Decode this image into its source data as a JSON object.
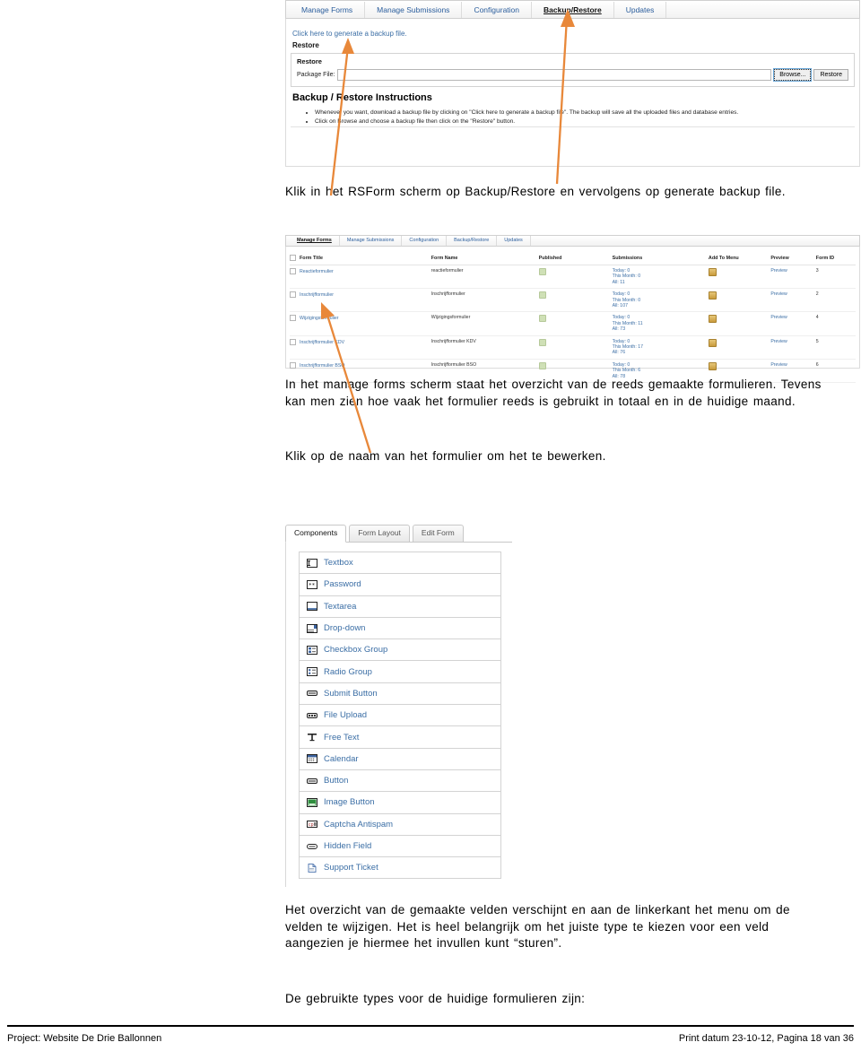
{
  "document": {
    "paragraphs": {
      "klik_backup": "Klik in het RSForm scherm op Backup/Restore en vervolgens op generate backup file.",
      "manage_forms": "In het manage forms scherm staat het overzicht van de reeds gemaakte formulieren. Tevens kan men zien hoe vaak het formulier reeds is gebruikt in totaal en in de huidige maand.",
      "klik_naam": "Klik op de naam van het formulier om het te bewerken.",
      "overzicht_velden": "Het overzicht van de gemaakte velden verschijnt en aan de linkerkant het menu om de velden te wijzigen. Het is heel belangrijk om het juiste type te kiezen voor een veld aangezien je hiermee het invullen kunt “sturen”.",
      "gebruikte_types": "De gebruikte types voor de huidige formulieren zijn:"
    },
    "footer": {
      "left": "Project: Website De Drie Ballonnen",
      "right": "Print datum 23-10-12, Pagina 18 van 36"
    }
  },
  "backup_screenshot": {
    "tabs": [
      {
        "label": "Manage Forms",
        "active": false
      },
      {
        "label": "Manage Submissions",
        "active": false
      },
      {
        "label": "Configuration",
        "active": false
      },
      {
        "label": "Backup/Restore",
        "active": true
      },
      {
        "label": "Updates",
        "active": false
      }
    ],
    "generate_link": "Click here to generate a backup file.",
    "restore_heading": "Restore",
    "panel_title": "Restore",
    "package_file_label": "Package File:",
    "package_file_value": "",
    "browse_button": "Browse...",
    "restore_button": "Restore",
    "instructions_heading": "Backup / Restore Instructions",
    "instructions": [
      "Whenever you want, download a backup file by clicking on \"Click here to generate a backup file\". The backup will save all the uploaded files and database entries.",
      "Click on Browse and choose a backup file then click on the \"Restore\" button."
    ]
  },
  "forms_screenshot": {
    "tabs": [
      {
        "label": "Manage Forms",
        "active": true
      },
      {
        "label": "Manage Submissions",
        "active": false
      },
      {
        "label": "Configuration",
        "active": false
      },
      {
        "label": "Backup/Restore",
        "active": false
      },
      {
        "label": "Updates",
        "active": false
      }
    ],
    "columns": [
      "Form Title",
      "Form Name",
      "Published",
      "Submissions",
      "Add To Menu",
      "Preview",
      "Form ID"
    ],
    "rows": [
      {
        "title": "Reactieformulier",
        "name": "reactieformulier",
        "published": true,
        "today": "Today: 0",
        "this_month": "This Month: 0",
        "all": "All: 11",
        "preview": "Preview",
        "form_id": "3"
      },
      {
        "title": "Inschrijfformulier",
        "name": "Inschrijfformulier",
        "published": true,
        "today": "Today: 0",
        "this_month": "This Month: 0",
        "all": "All: 107",
        "preview": "Preview",
        "form_id": "2"
      },
      {
        "title": "Wijzigingsformulier",
        "name": "Wijzigingsformulier",
        "published": true,
        "today": "Today: 0",
        "this_month": "This Month: 11",
        "all": "All: 73",
        "preview": "Preview",
        "form_id": "4"
      },
      {
        "title": "Inschrijfformulier KDV",
        "name": "Inschrijfformulier KDV",
        "published": true,
        "today": "Today: 0",
        "this_month": "This Month: 17",
        "all": "All: 76",
        "preview": "Preview",
        "form_id": "5"
      },
      {
        "title": "Inschrijfformulier BSO",
        "name": "Inschrijfformulier BSO",
        "published": true,
        "today": "Today: 0",
        "this_month": "This Month: 6",
        "all": "All: 78",
        "preview": "Preview",
        "form_id": "6"
      }
    ]
  },
  "components_screenshot": {
    "tabs": [
      {
        "label": "Components",
        "active": true
      },
      {
        "label": "Form Layout",
        "active": false
      },
      {
        "label": "Edit Form",
        "active": false
      }
    ],
    "items": [
      {
        "label": "Textbox",
        "icon": "textbox-icon"
      },
      {
        "label": "Password",
        "icon": "password-icon"
      },
      {
        "label": "Textarea",
        "icon": "textarea-icon"
      },
      {
        "label": "Drop-down",
        "icon": "dropdown-icon"
      },
      {
        "label": "Checkbox Group",
        "icon": "checkbox-group-icon"
      },
      {
        "label": "Radio Group",
        "icon": "radio-group-icon"
      },
      {
        "label": "Submit Button",
        "icon": "submit-button-icon"
      },
      {
        "label": "File Upload",
        "icon": "file-upload-icon"
      },
      {
        "label": "Free Text",
        "icon": "free-text-icon"
      },
      {
        "label": "Calendar",
        "icon": "calendar-icon"
      },
      {
        "label": "Button",
        "icon": "button-icon"
      },
      {
        "label": "Image Button",
        "icon": "image-button-icon"
      },
      {
        "label": "Captcha Antispam",
        "icon": "captcha-icon"
      },
      {
        "label": "Hidden Field",
        "icon": "hidden-field-icon"
      },
      {
        "label": "Support Ticket",
        "icon": "support-ticket-icon"
      }
    ]
  },
  "annotations": {
    "arrow_color": "#E8883A",
    "arrows": [
      {
        "name": "arrow-to-generate-backup-link"
      },
      {
        "name": "arrow-to-backup-restore-tab"
      },
      {
        "name": "arrow-to-form-title-link"
      }
    ]
  }
}
